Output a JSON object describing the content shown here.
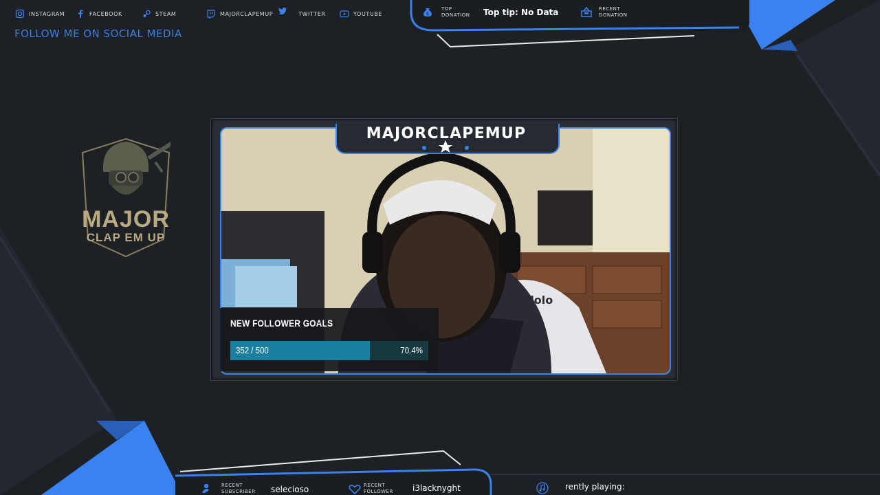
{
  "social": {
    "items": [
      {
        "label": "INSTAGRAM",
        "icon": "instagram-icon"
      },
      {
        "label": "FACEBOOK",
        "icon": "facebook-icon"
      },
      {
        "label": "STEAM",
        "icon": "steam-icon"
      },
      {
        "label": "MAJORCLAPEMUP",
        "icon": "twitch-icon"
      },
      {
        "label": "TWITTER",
        "icon": "twitter-icon"
      },
      {
        "label": "YOUTUBE",
        "icon": "youtube-icon"
      }
    ],
    "follow_title": "FOLLOW ME ON SOCIAL MEDIA"
  },
  "donation": {
    "top_label_1": "TOP",
    "top_label_2": "DONATION",
    "top_value": "Top tip: No Data",
    "recent_label_1": "RECENT",
    "recent_label_2": "DONATION"
  },
  "logo": {
    "line1": "MAJOR",
    "line2": "CLAP EM UP"
  },
  "camera": {
    "channel_name": "MAJORCLAPEMUP",
    "chair_brand": "zlolo"
  },
  "goal": {
    "title": "NEW FOLLOWER GOALS",
    "count": "352 / 500",
    "percent_text": "70.4%",
    "progress": 0.704
  },
  "bottom": {
    "subscriber_label_1": "RECENT",
    "subscriber_label_2": "SUBSCRIBER",
    "subscriber_value": "selecioso",
    "follower_label_1": "RECENT",
    "follower_label_2": "FOLLOWER",
    "follower_value": "i3lacknyght",
    "now_playing": "rently playing:"
  },
  "colors": {
    "accent": "#3a82f0",
    "background": "#1d2126",
    "goal_fill": "#1b7fa0"
  }
}
